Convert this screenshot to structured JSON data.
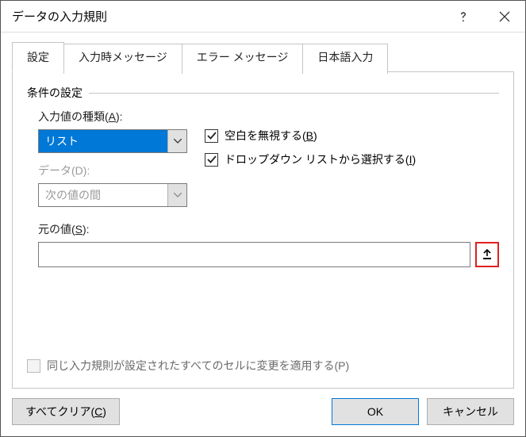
{
  "title": "データの入力規則",
  "tabs": {
    "settings": "設定",
    "input_msg": "入力時メッセージ",
    "error_msg": "エラー メッセージ",
    "ime": "日本語入力"
  },
  "fieldset": {
    "legend": "条件の設定",
    "allow_label_pre": "入力値の種類(",
    "allow_key": "A",
    "allow_label_post": "):",
    "allow_value": "リスト",
    "data_label_pre": "データ(",
    "data_key": "D",
    "data_label_post": "):",
    "data_value": "次の値の間",
    "ignore_blank_pre": "空白を無視する(",
    "ignore_blank_key": "B",
    "ignore_blank_post": ")",
    "dropdown_pre": "ドロップダウン リストから選択する(",
    "dropdown_key": "I",
    "dropdown_post": ")",
    "source_label_pre": "元の値(",
    "source_key": "S",
    "source_label_post": "):",
    "source_value": "",
    "apply_all_pre": "同じ入力規則が設定されたすべてのセルに変更を適用する(",
    "apply_all_key": "P",
    "apply_all_post": ")"
  },
  "buttons": {
    "clear_all_pre": "すべてクリア(",
    "clear_all_key": "C",
    "clear_all_post": ")",
    "ok": "OK",
    "cancel": "キャンセル"
  }
}
